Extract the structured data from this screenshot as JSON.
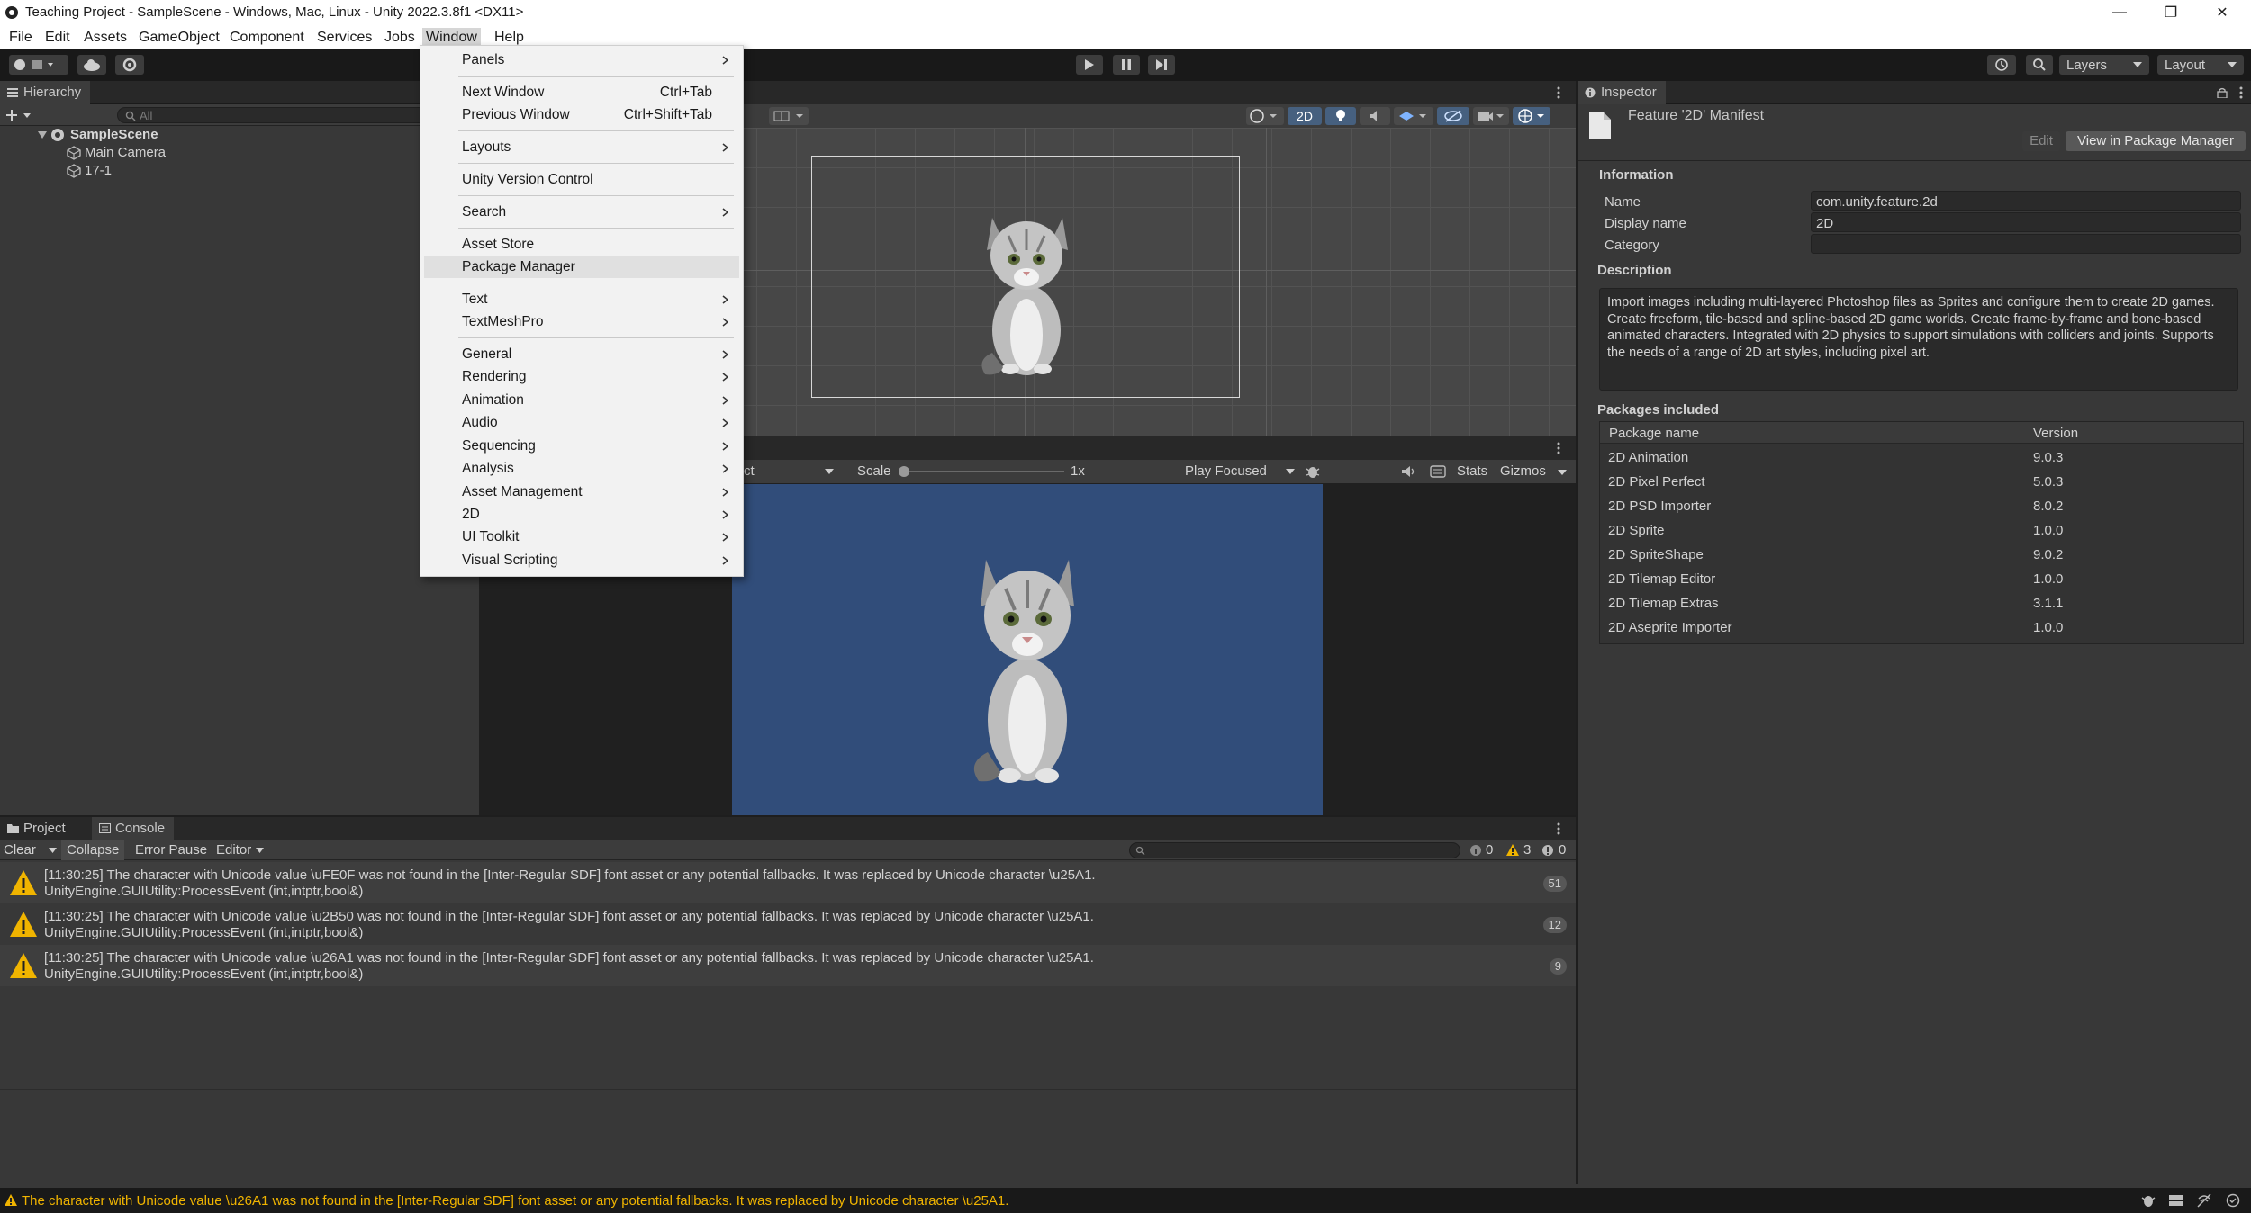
{
  "window": {
    "title": "Teaching Project - SampleScene - Windows, Mac, Linux - Unity 2022.3.8f1 <DX11>"
  },
  "menubar": [
    "File",
    "Edit",
    "Assets",
    "GameObject",
    "Component",
    "Services",
    "Jobs",
    "Window",
    "Help"
  ],
  "toolbar": {
    "layers_label": "Layers",
    "layout_label": "Layout"
  },
  "hierarchy": {
    "tab": "Hierarchy",
    "search_placeholder": "All",
    "scene": "SampleScene",
    "items": [
      "Main Camera",
      "17-1"
    ]
  },
  "scene_view": {
    "mode_2d": "2D"
  },
  "game_view": {
    "display_label": "ct",
    "scale_label": "Scale",
    "scale_value": "1x",
    "play_mode": "Play Focused",
    "stats_label": "Stats",
    "gizmos_label": "Gizmos"
  },
  "window_menu": {
    "items": [
      {
        "label": "Panels",
        "submenu": true
      },
      {
        "label": "Next Window",
        "shortcut": "Ctrl+Tab"
      },
      {
        "label": "Previous Window",
        "shortcut": "Ctrl+Shift+Tab"
      },
      {
        "label": "Layouts",
        "submenu": true
      },
      {
        "label": "Unity Version Control"
      },
      {
        "label": "Search",
        "submenu": true
      },
      {
        "label": "Asset Store"
      },
      {
        "label": "Package Manager",
        "highlighted": true
      },
      {
        "label": "Text",
        "submenu": true
      },
      {
        "label": "TextMeshPro",
        "submenu": true
      },
      {
        "label": "General",
        "submenu": true
      },
      {
        "label": "Rendering",
        "submenu": true
      },
      {
        "label": "Animation",
        "submenu": true
      },
      {
        "label": "Audio",
        "submenu": true
      },
      {
        "label": "Sequencing",
        "submenu": true
      },
      {
        "label": "Analysis",
        "submenu": true
      },
      {
        "label": "Asset Management",
        "submenu": true
      },
      {
        "label": "2D",
        "submenu": true
      },
      {
        "label": "UI Toolkit",
        "submenu": true
      },
      {
        "label": "Visual Scripting",
        "submenu": true
      }
    ]
  },
  "inspector": {
    "tab": "Inspector",
    "asset_title": "Feature '2D' Manifest",
    "edit_button": "Edit",
    "package_manager_button": "View in Package Manager",
    "information_header": "Information",
    "fields": [
      {
        "label": "Name",
        "value": "com.unity.feature.2d"
      },
      {
        "label": "Display name",
        "value": "2D"
      },
      {
        "label": "Category",
        "value": ""
      }
    ],
    "description_header": "Description",
    "description": "Import images including multi-layered Photoshop files as Sprites and configure them to create 2D games. Create freeform, tile-based and spline-based 2D game worlds. Create frame-by-frame and bone-based animated characters. Integrated with 2D physics to support simulations with colliders and joints. Supports the needs of a range of 2D art styles, including pixel art.",
    "packages_header": "Packages included",
    "col_name": "Package name",
    "col_version": "Version",
    "packages": [
      {
        "name": "2D Animation",
        "version": "9.0.3"
      },
      {
        "name": "2D Pixel Perfect",
        "version": "5.0.3"
      },
      {
        "name": "2D PSD Importer",
        "version": "8.0.2"
      },
      {
        "name": "2D Sprite",
        "version": "1.0.0"
      },
      {
        "name": "2D SpriteShape",
        "version": "9.0.2"
      },
      {
        "name": "2D Tilemap Editor",
        "version": "1.0.0"
      },
      {
        "name": "2D Tilemap Extras",
        "version": "3.1.1"
      },
      {
        "name": "2D Aseprite Importer",
        "version": "1.0.0"
      }
    ]
  },
  "console": {
    "tabs": [
      "Project",
      "Console"
    ],
    "clear": "Clear",
    "collapse": "Collapse",
    "error_pause": "Error Pause",
    "editor": "Editor",
    "count_log": "0",
    "count_warn": "3",
    "count_error": "0",
    "logs": [
      {
        "line1": "[11:30:25] The character with Unicode value \\uFE0F was not found in the [Inter-Regular SDF] font asset or any potential fallbacks. It was replaced by Unicode character \\u25A1.",
        "line2": "UnityEngine.GUIUtility:ProcessEvent (int,intptr,bool&)",
        "count": "51"
      },
      {
        "line1": "[11:30:25] The character with Unicode value \\u2B50 was not found in the [Inter-Regular SDF] font asset or any potential fallbacks. It was replaced by Unicode character \\u25A1.",
        "line2": "UnityEngine.GUIUtility:ProcessEvent (int,intptr,bool&)",
        "count": "12"
      },
      {
        "line1": "[11:30:25] The character with Unicode value \\u26A1 was not found in the [Inter-Regular SDF] font asset or any potential fallbacks. It was replaced by Unicode character \\u25A1.",
        "line2": "UnityEngine.GUIUtility:ProcessEvent (int,intptr,bool&)",
        "count": "9"
      }
    ]
  },
  "statusbar": {
    "message": "The character with Unicode value \\u26A1 was not found in the [Inter-Regular SDF] font asset or any potential fallbacks. It was replaced by Unicode character \\u25A1."
  },
  "colors": {
    "accent": "#4d6eb3",
    "game_bg": "#314d7a",
    "warning": "#f0b400"
  }
}
